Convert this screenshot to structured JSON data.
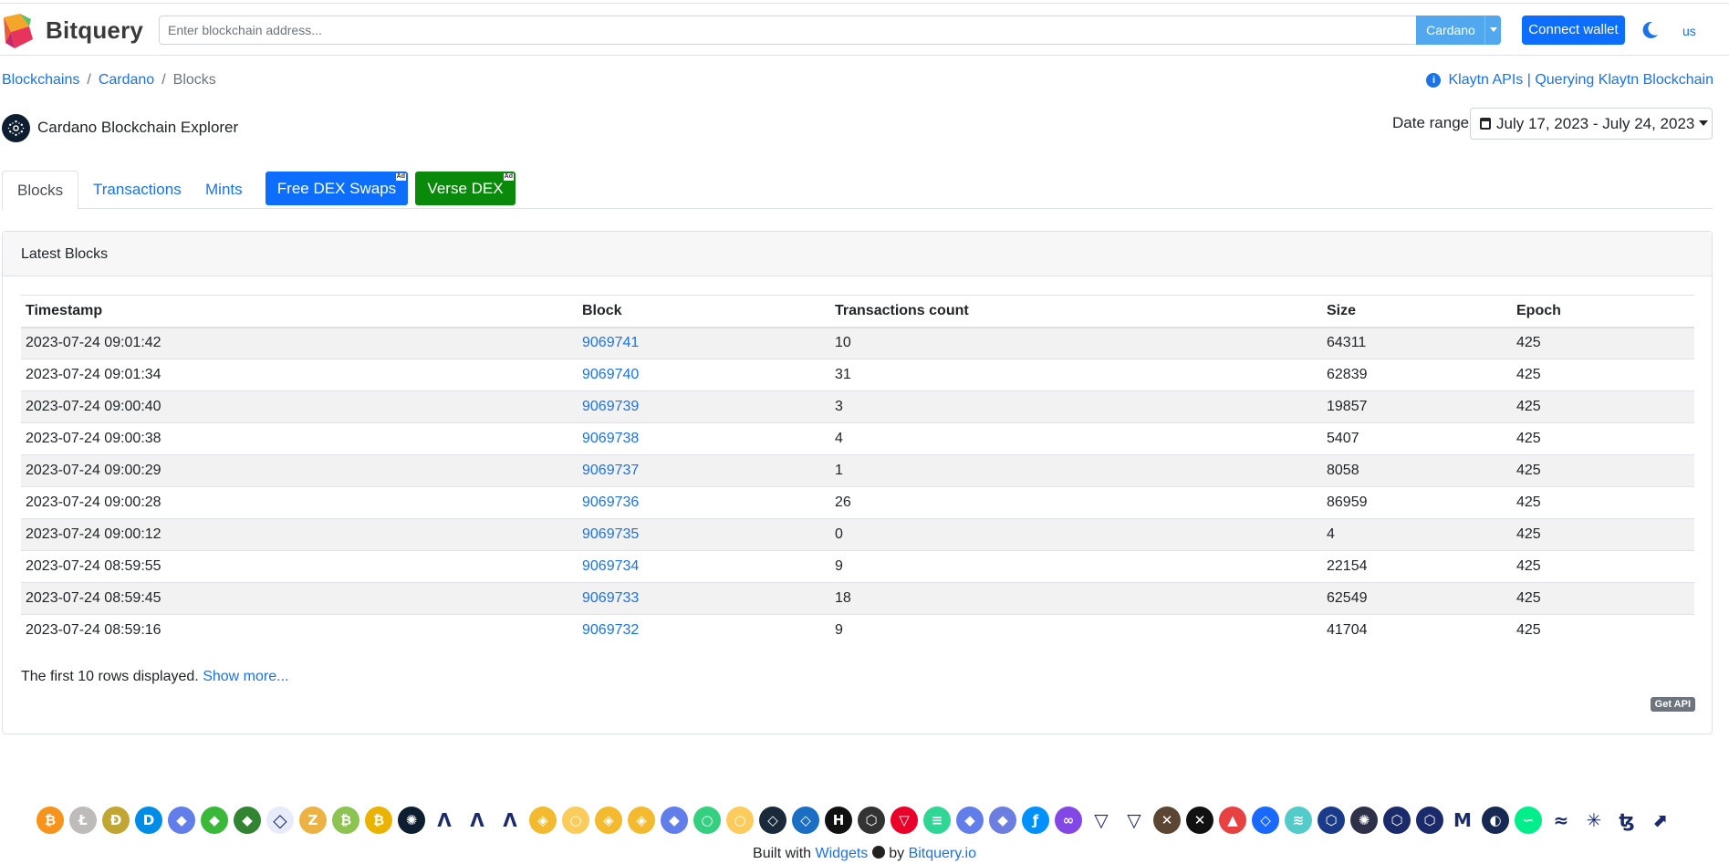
{
  "header": {
    "brand": "Bitquery",
    "search_placeholder": "Enter blockchain address...",
    "chain_selector": "Cardano",
    "connect_wallet": "Connect wallet",
    "language": "us"
  },
  "breadcrumb": {
    "items": [
      "Blockchains",
      "Cardano"
    ],
    "current": "Blocks"
  },
  "promo_link": "Klaytn APIs | Querying Klaytn Blockchain",
  "explorer_title": "Cardano Blockchain Explorer",
  "date_range": {
    "label": "Date range",
    "value": "July 17, 2023 - July 24, 2023"
  },
  "tabs": [
    "Blocks",
    "Transactions",
    "Mints"
  ],
  "ads": {
    "ad1": "Free DEX Swaps",
    "ad2": "Verse DEX",
    "badge": "Ad"
  },
  "card": {
    "title": "Latest Blocks",
    "columns": [
      "Timestamp",
      "Block",
      "Transactions count",
      "Size",
      "Epoch"
    ],
    "rows": [
      [
        "2023-07-24 09:01:42",
        "9069741",
        "10",
        "64311",
        "425"
      ],
      [
        "2023-07-24 09:01:34",
        "9069740",
        "31",
        "62839",
        "425"
      ],
      [
        "2023-07-24 09:00:40",
        "9069739",
        "3",
        "19857",
        "425"
      ],
      [
        "2023-07-24 09:00:38",
        "9069738",
        "4",
        "5407",
        "425"
      ],
      [
        "2023-07-24 09:00:29",
        "9069737",
        "1",
        "8058",
        "425"
      ],
      [
        "2023-07-24 09:00:28",
        "9069736",
        "26",
        "86959",
        "425"
      ],
      [
        "2023-07-24 09:00:12",
        "9069735",
        "0",
        "4",
        "425"
      ],
      [
        "2023-07-24 08:59:55",
        "9069734",
        "9",
        "22154",
        "425"
      ],
      [
        "2023-07-24 08:59:45",
        "9069733",
        "18",
        "62549",
        "425"
      ],
      [
        "2023-07-24 08:59:16",
        "9069732",
        "9",
        "41704",
        "425"
      ]
    ],
    "footnote": "The first 10 rows displayed.",
    "show_more": "Show more...",
    "get_api": "Get API"
  },
  "coins": [
    {
      "name": "bitcoin-icon",
      "color": "#f7931a",
      "glyph": "₿"
    },
    {
      "name": "litecoin-icon",
      "color": "#bfbbbb",
      "glyph": "Ł"
    },
    {
      "name": "dogecoin-icon",
      "color": "#c2a633",
      "glyph": "Ð"
    },
    {
      "name": "dash-icon",
      "color": "#008ce7",
      "glyph": "D"
    },
    {
      "name": "ethereum-icon",
      "color": "#627eea",
      "glyph": "◆"
    },
    {
      "name": "ethereum-classic-icon",
      "color": "#3ab83a",
      "glyph": "◆"
    },
    {
      "name": "ethereum-classic-alt-icon",
      "color": "#328332",
      "glyph": "◆"
    },
    {
      "name": "ethereum-outline-icon",
      "color": "#e8ecfa",
      "glyph": "◇"
    },
    {
      "name": "zcash-icon",
      "color": "#ecb244",
      "glyph": "Z"
    },
    {
      "name": "bitcoin-cash-icon",
      "color": "#8dc351",
      "glyph": "₿"
    },
    {
      "name": "bitcoin-sv-icon",
      "color": "#eab300",
      "glyph": "₿"
    },
    {
      "name": "cardano-icon",
      "color": "#0d1e30",
      "glyph": "✺"
    },
    {
      "name": "algorand-icon",
      "color": "#ffffff",
      "glyph": "Λ"
    },
    {
      "name": "algorand-alt-icon",
      "color": "#ffffff",
      "glyph": "Λ"
    },
    {
      "name": "algorand-testnet-icon",
      "color": "#ffffff",
      "glyph": "Λ"
    },
    {
      "name": "bnb-icon",
      "color": "#f3ba2f",
      "glyph": "◈"
    },
    {
      "name": "celo-icon",
      "color": "#fbcc5c",
      "glyph": "○"
    },
    {
      "name": "bnb-chain-icon",
      "color": "#f3ba2f",
      "glyph": "◈"
    },
    {
      "name": "bnb-testnet-icon",
      "color": "#f3ba2f",
      "glyph": "◈"
    },
    {
      "name": "goerli-icon",
      "color": "#627eea",
      "glyph": "◆"
    },
    {
      "name": "celo-alt-icon",
      "color": "#35d07f",
      "glyph": "○"
    },
    {
      "name": "celo-testnet-icon",
      "color": "#fbcc5c",
      "glyph": "○"
    },
    {
      "name": "conflux-icon",
      "color": "#1a2a3a",
      "glyph": "◇"
    },
    {
      "name": "conflux-alt-icon",
      "color": "#1a6fc4",
      "glyph": "◇"
    },
    {
      "name": "hedera-icon",
      "color": "#111111",
      "glyph": "H"
    },
    {
      "name": "eos-icon",
      "color": "#333333",
      "glyph": "⬡"
    },
    {
      "name": "tron-icon",
      "color": "#eb0029",
      "glyph": "▽"
    },
    {
      "name": "solana-icon",
      "color": "#2fd694",
      "glyph": "≡"
    },
    {
      "name": "ethpow-icon",
      "color": "#627eea",
      "glyph": "◆"
    },
    {
      "name": "ethereum-alt-icon",
      "color": "#6c7fe0",
      "glyph": "◆"
    },
    {
      "name": "filecoin-icon",
      "color": "#0090ff",
      "glyph": "ƒ"
    },
    {
      "name": "polygon-icon",
      "color": "#8247e5",
      "glyph": "∞"
    },
    {
      "name": "velas-icon",
      "color": "#ffffff",
      "glyph": "▽"
    },
    {
      "name": "velas-alt-icon",
      "color": "#ffffff",
      "glyph": "▽"
    },
    {
      "name": "near-icon",
      "color": "#5a4632",
      "glyph": "✕"
    },
    {
      "name": "xinfin-icon",
      "color": "#111111",
      "glyph": "✕"
    },
    {
      "name": "avalanche-icon",
      "color": "#e84142",
      "glyph": "▲"
    },
    {
      "name": "fantom-icon",
      "color": "#1969ff",
      "glyph": "◇"
    },
    {
      "name": "moonbeam-icon",
      "color": "#53cbc8",
      "glyph": "≋"
    },
    {
      "name": "chainlink-icon",
      "color": "#1a3a8a",
      "glyph": "⬡"
    },
    {
      "name": "cosmos-icon",
      "color": "#2e3148",
      "glyph": "✺"
    },
    {
      "name": "chain-icon",
      "color": "#1a2a6a",
      "glyph": "⬡"
    },
    {
      "name": "chain-alt-icon",
      "color": "#1a2a6a",
      "glyph": "⬡"
    },
    {
      "name": "medibloc-icon",
      "color": "#ffffff",
      "glyph": "M"
    },
    {
      "name": "terra-icon",
      "color": "#172852",
      "glyph": "◐"
    },
    {
      "name": "flow-icon",
      "color": "#00ef8b",
      "glyph": "∽"
    },
    {
      "name": "stellar-icon",
      "color": "#ffffff",
      "glyph": "≈"
    },
    {
      "name": "ripple-icon",
      "color": "#ffffff",
      "glyph": "✳"
    },
    {
      "name": "tezos-icon",
      "color": "#ffffff",
      "glyph": "ꜩ"
    },
    {
      "name": "bitquery-arrow-icon",
      "color": "#ffffff",
      "glyph": "⬈"
    }
  ],
  "footer": {
    "prefix": "Built with",
    "widgets": "Widgets",
    "by": "by",
    "site": "Bitquery.io"
  }
}
